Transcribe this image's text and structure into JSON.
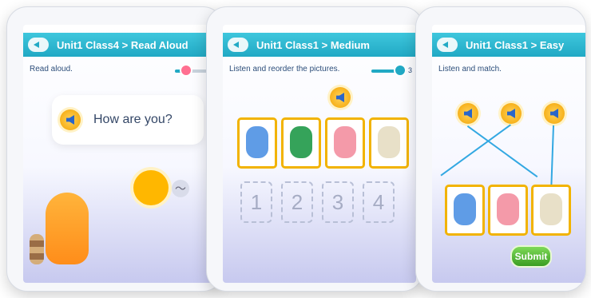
{
  "panels": [
    {
      "title": "Unit1 Class4 > Read Aloud",
      "instruction": "Read aloud.",
      "prompt": "How are you?",
      "progress": 0.2
    },
    {
      "title": "Unit1 Class1 > Medium",
      "instruction": "Listen and reorder the pictures.",
      "progress_label": "3",
      "progress": 0.75,
      "slots": [
        "1",
        "2",
        "3",
        "4"
      ]
    },
    {
      "title": "Unit1 Class1 > Easy",
      "instruction": "Listen and match.",
      "submit_label": "Submit"
    }
  ],
  "icons": {
    "back": "back-arrow-icon",
    "speaker": "speaker-icon",
    "mic": "microphone-icon",
    "sound": "sound-wave-icon"
  },
  "colors": {
    "header": "#21a9c4",
    "speaker": "#f3a300",
    "frame": "#f2b300",
    "submit": "#3a9d23",
    "line": "#33a8e2"
  }
}
